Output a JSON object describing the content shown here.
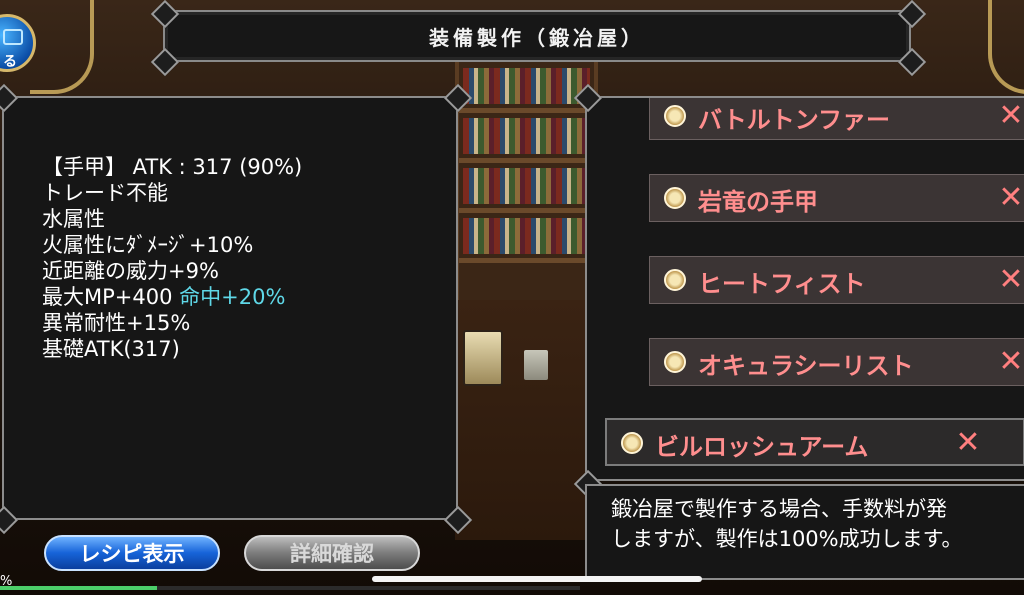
{
  "header": {
    "title": "装備製作（鍛冶屋）"
  },
  "top_left_badge": {
    "label": "る"
  },
  "stats": {
    "line1": "【手甲】 ATK : 317 (90%)",
    "line2": "トレード不能",
    "line3": "水属性",
    "line4": "火属性にﾀﾞﾒｰｼﾞ+10%",
    "line5": "近距離の威力+9%",
    "line6_a": "最大MP+400",
    "line6_b": "命中+20%",
    "line7": "異常耐性+15%",
    "line8": "基礎ATK(317)"
  },
  "buttons": {
    "recipe": "レシピ表示",
    "detail": "詳細確認"
  },
  "recipes": [
    {
      "name": "バトルトンファー"
    },
    {
      "name": "岩竜の手甲"
    },
    {
      "name": "ヒートフィスト"
    },
    {
      "name": "オキュラシーリスト"
    },
    {
      "name": "ビルロッシュアーム"
    }
  ],
  "remove_glyph": "✕",
  "description": "鍛冶屋で製作する場合、手数料が発\nしますが、製作は100%成功します。",
  "bottom": {
    "percent_glyph": "%",
    "progress": 0.27
  },
  "icons": {
    "recipe_item": "scroll-icon",
    "remove": "close-icon"
  },
  "colors": {
    "recipe_text": "#ff8e8e",
    "accent_stat": "#5fd8e8",
    "primary_button": "#1663d8"
  }
}
